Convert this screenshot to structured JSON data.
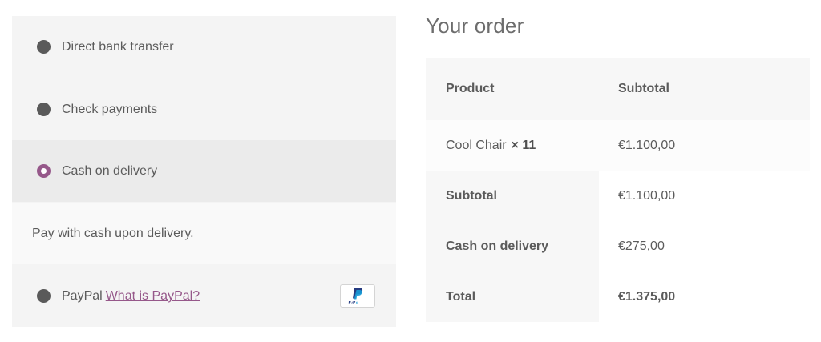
{
  "payment_methods": {
    "items": [
      {
        "label": "Direct bank transfer",
        "selected": false
      },
      {
        "label": "Check payments",
        "selected": false
      },
      {
        "label": "Cash on delivery",
        "selected": true
      },
      {
        "label": "PayPal",
        "selected": false
      }
    ],
    "selected_description": "Pay with cash upon delivery.",
    "paypal_link_text": "What is PayPal?",
    "paypal_logo_icon": "paypal-logo-icon"
  },
  "order": {
    "title": "Your order",
    "columns": [
      "Product",
      "Subtotal"
    ],
    "items": [
      {
        "name": "Cool Chair",
        "quantity": "× 11",
        "subtotal": "€1.100,00"
      }
    ],
    "totals": [
      {
        "label": "Subtotal",
        "value": "€1.100,00"
      },
      {
        "label": "Cash on delivery",
        "value": "€275,00"
      },
      {
        "label": "Total",
        "value": "€1.375,00"
      }
    ]
  },
  "colors": {
    "accent": "#96588a",
    "panel_bg": "#f4f4f4",
    "selected_row_bg": "#ebebeb"
  }
}
